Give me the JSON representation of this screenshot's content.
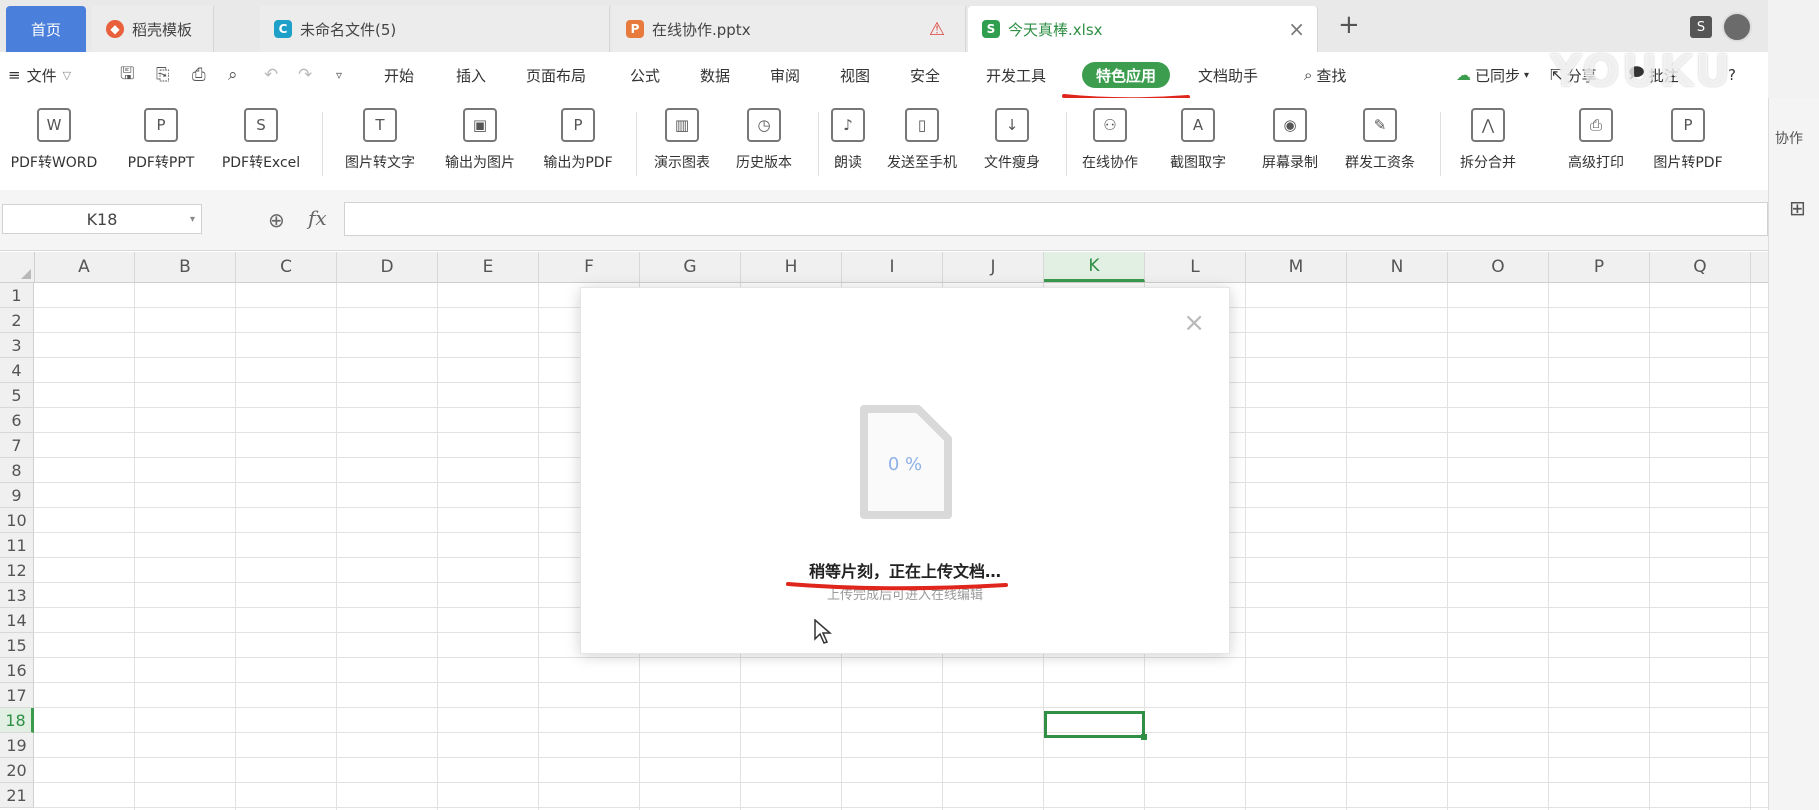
{
  "tabs": [
    {
      "label": "首页"
    },
    {
      "label": "稻壳模板",
      "icon": "daoke-icon",
      "color": "#e8603c"
    },
    {
      "label": "未命名文件(5)",
      "icon": "cloud-doc-icon",
      "color": "#1ea0c8"
    },
    {
      "label": "在线协作.pptx",
      "icon": "pptx-icon",
      "color": "#e87a3d"
    },
    {
      "label": "今天真棒.xlsx",
      "icon": "xlsx-icon",
      "color": "#2f9e4f"
    }
  ],
  "menu": {
    "file": "文件",
    "items": [
      "开始",
      "插入",
      "页面布局",
      "公式",
      "数据",
      "审阅",
      "视图",
      "安全",
      "开发工具",
      "特色应用",
      "文档助手",
      "查找"
    ],
    "active": "特色应用",
    "sync": "已同步",
    "share": "分享",
    "comment": "批注",
    "help": "?"
  },
  "ribbon": [
    {
      "label": "PDF转WORD",
      "glyph": "W"
    },
    {
      "label": "PDF转PPT",
      "glyph": "P"
    },
    {
      "label": "PDF转Excel",
      "glyph": "S"
    },
    {
      "label": "图片转文字",
      "glyph": "T"
    },
    {
      "label": "输出为图片",
      "glyph": "▣"
    },
    {
      "label": "输出为PDF",
      "glyph": "P"
    },
    {
      "label": "演示图表",
      "glyph": "▥"
    },
    {
      "label": "历史版本",
      "glyph": "◷"
    },
    {
      "label": "朗读",
      "glyph": "♪"
    },
    {
      "label": "发送至手机",
      "glyph": "▯"
    },
    {
      "label": "文件瘦身",
      "glyph": "↓"
    },
    {
      "label": "在线协作",
      "glyph": "⚇"
    },
    {
      "label": "截图取字",
      "glyph": "A"
    },
    {
      "label": "屏幕录制",
      "glyph": "◉"
    },
    {
      "label": "群发工资条",
      "glyph": "✎"
    },
    {
      "label": "拆分合并",
      "glyph": "⋀"
    },
    {
      "label": "高级打印",
      "glyph": "⎙"
    },
    {
      "label": "图片转PDF",
      "glyph": "P"
    }
  ],
  "namebox": "K18",
  "fx": "fx",
  "columns": [
    "A",
    "B",
    "C",
    "D",
    "E",
    "F",
    "G",
    "H",
    "I",
    "J",
    "K",
    "L",
    "M",
    "N",
    "O",
    "P",
    "Q"
  ],
  "rows": [
    "1",
    "2",
    "3",
    "4",
    "5",
    "6",
    "7",
    "8",
    "9",
    "10",
    "11",
    "12",
    "13",
    "14",
    "15",
    "16",
    "17",
    "18",
    "19",
    "20",
    "21"
  ],
  "selected_col": "K",
  "selected_row": "18",
  "dialog": {
    "progress": "0 %",
    "message": "稍等片刻，正在上传文档…",
    "submessage": "上传完成后可进入在线编辑"
  },
  "rightpanel": {
    "tab": "协作",
    "icon": "grid-icon"
  },
  "watermark": "YOUKU",
  "colors": {
    "accent": "#3c9d4e",
    "selection": "#2f8f45",
    "annotation": "#e0251c",
    "home_tab": "#4a7fdc"
  }
}
